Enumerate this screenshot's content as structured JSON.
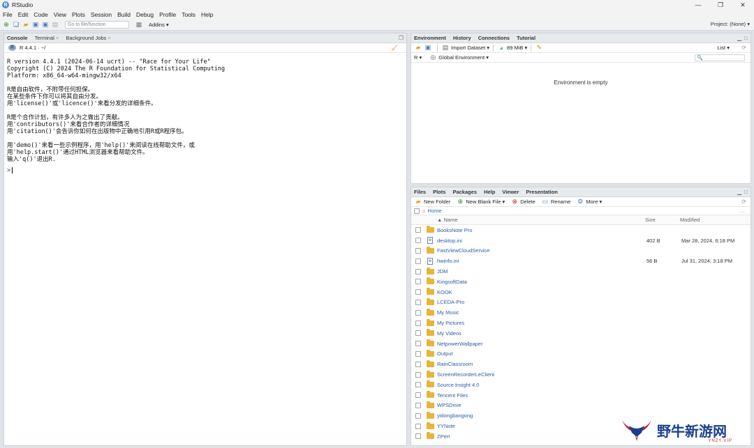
{
  "window": {
    "title": "RStudio",
    "minimize": "—",
    "maximize": "❐",
    "close": "✕"
  },
  "menu": [
    "File",
    "Edit",
    "Code",
    "View",
    "Plots",
    "Session",
    "Build",
    "Debug",
    "Profile",
    "Tools",
    "Help"
  ],
  "toolbar": {
    "goto_placeholder": "Go to file/function",
    "addins": "Addins ▾",
    "project": "Project: (None) ▾"
  },
  "console_pane": {
    "tabs": [
      "Console",
      "Terminal",
      "Background Jobs"
    ],
    "version_label": "R 4.4.1 · ~/",
    "lines": [
      "R version 4.4.1 (2024-06-14 ucrt) -- \"Race for Your Life\"",
      "Copyright (C) 2024 The R Foundation for Statistical Computing",
      "Platform: x86_64-w64-mingw32/x64",
      "",
      "R是自由软件，不附带任何担保。",
      "在某些条件下你可以将其自由分发。",
      "用'license()'或'licence()'来看分发的详细条件。",
      "",
      "R是个合作计划，有许多人为之做出了贡献。",
      "用'contributors()'来看合作者的详细情况",
      "用'citation()'会告诉你如何在出版物中正确地引用R或R程序包。",
      "",
      "用'demo()'来看一些示例程序，用'help()'来阅读在线帮助文件，或",
      "用'help.start()'通过HTML浏览器来看帮助文件。",
      "输入'q()'退出R."
    ],
    "prompt": ">"
  },
  "env_pane": {
    "tabs": [
      "Environment",
      "History",
      "Connections",
      "Tutorial"
    ],
    "import_dataset": "Import Dataset ▾",
    "memory": "89 MiB ▾",
    "list_view": "List ▾",
    "r_label": "R ▾",
    "scope": "Global Environment ▾",
    "search_placeholder": "",
    "empty_message": "Environment is empty"
  },
  "files_pane": {
    "tabs": [
      "Files",
      "Plots",
      "Packages",
      "Help",
      "Viewer",
      "Presentation"
    ],
    "new_folder": "New Folder",
    "new_blank_file": "New Blank File ▾",
    "delete": "Delete",
    "rename": "Rename",
    "more": "More ▾",
    "home": "Home",
    "columns": {
      "name": "▲ Name",
      "size": "Size",
      "modified": "Modified"
    },
    "files": [
      {
        "name": "BooksNote Pro",
        "type": "folder",
        "size": "",
        "modified": ""
      },
      {
        "name": "desktop.ini",
        "type": "file",
        "size": "402 B",
        "modified": "Mar 28, 2024, 6:18 PM"
      },
      {
        "name": "FastViewCloudService",
        "type": "folder",
        "size": "",
        "modified": ""
      },
      {
        "name": "hwinfo.ini",
        "type": "file",
        "size": "56 B",
        "modified": "Jul 31, 2024, 3:18 PM"
      },
      {
        "name": "JDM",
        "type": "folder",
        "size": "",
        "modified": ""
      },
      {
        "name": "KingsoftData",
        "type": "folder",
        "size": "",
        "modified": ""
      },
      {
        "name": "KOOK",
        "type": "folder",
        "size": "",
        "modified": ""
      },
      {
        "name": "LCEDA-Pro",
        "type": "folder",
        "size": "",
        "modified": ""
      },
      {
        "name": "My Music",
        "type": "folder",
        "size": "",
        "modified": ""
      },
      {
        "name": "My Pictures",
        "type": "folder",
        "size": "",
        "modified": ""
      },
      {
        "name": "My Videos",
        "type": "folder",
        "size": "",
        "modified": ""
      },
      {
        "name": "NetpowerWallpaper",
        "type": "folder",
        "size": "",
        "modified": ""
      },
      {
        "name": "Output",
        "type": "folder",
        "size": "",
        "modified": ""
      },
      {
        "name": "RainClassroom",
        "type": "folder",
        "size": "",
        "modified": ""
      },
      {
        "name": "ScreenRecorderLeClient",
        "type": "folder",
        "size": "",
        "modified": ""
      },
      {
        "name": "Source Insight 4.0",
        "type": "folder",
        "size": "",
        "modified": ""
      },
      {
        "name": "Tencent Files",
        "type": "folder",
        "size": "",
        "modified": ""
      },
      {
        "name": "WPSDrive",
        "type": "folder",
        "size": "",
        "modified": ""
      },
      {
        "name": "yidongbangong",
        "type": "folder",
        "size": "",
        "modified": ""
      },
      {
        "name": "YYNote",
        "type": "folder",
        "size": "",
        "modified": ""
      },
      {
        "name": "ZPert",
        "type": "folder",
        "size": "",
        "modified": ""
      }
    ]
  },
  "watermark": {
    "text": "野牛新游网",
    "sub": "YNZY.VIP"
  }
}
